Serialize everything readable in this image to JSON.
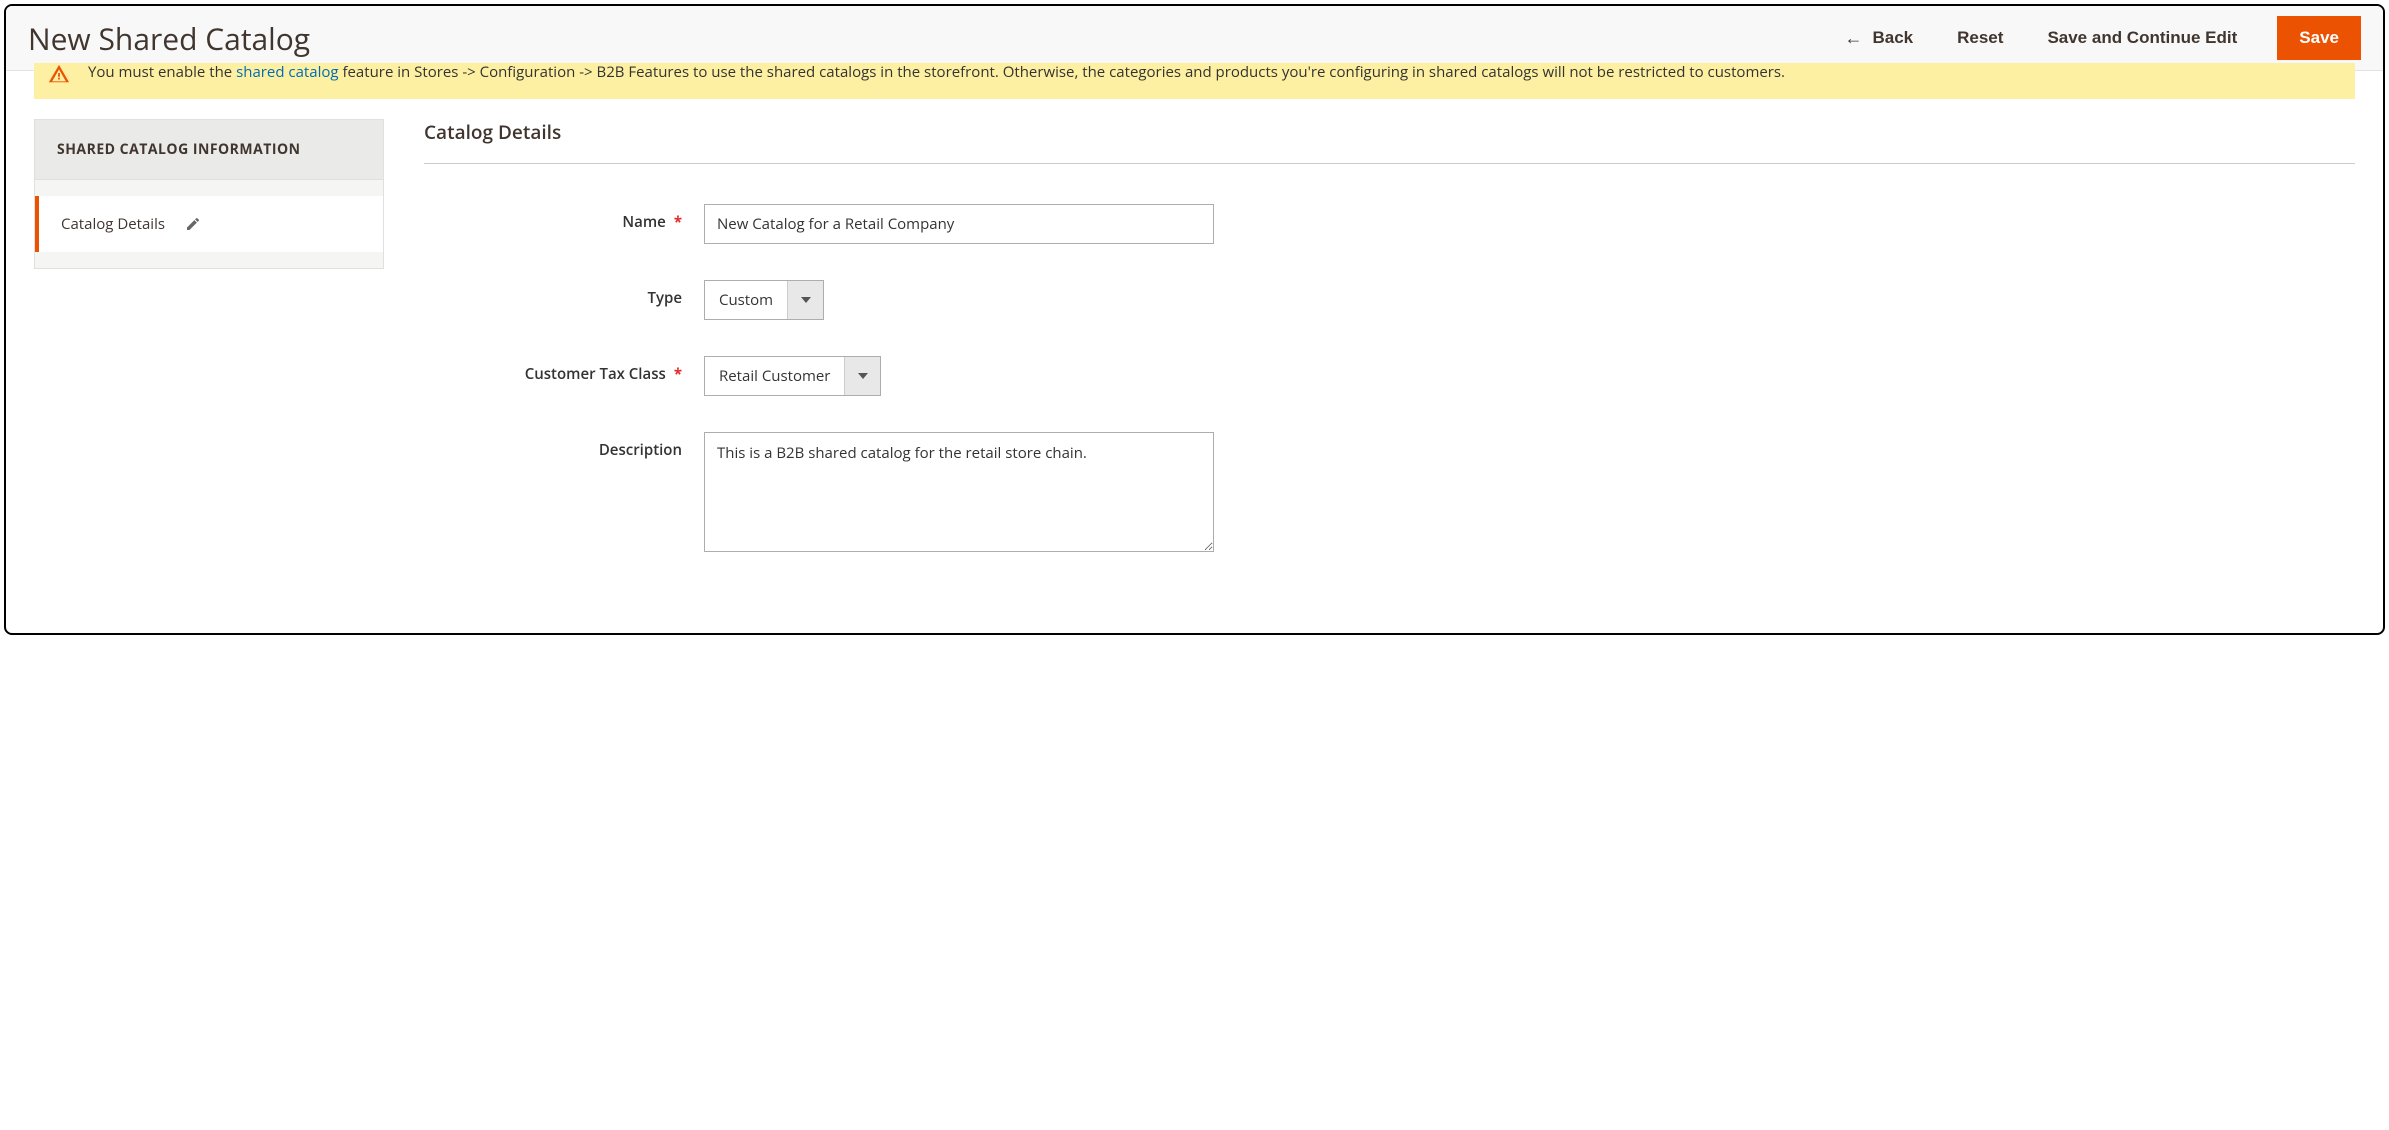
{
  "header": {
    "title": "New Shared Catalog",
    "actions": {
      "back": "Back",
      "reset": "Reset",
      "save_continue": "Save and Continue Edit",
      "save": "Save"
    }
  },
  "notice": {
    "pre_link": "You must enable the ",
    "link_text": "shared catalog",
    "post_link": " feature in Stores -> Configuration -> B2B Features to use the shared catalogs in the storefront. Otherwise, the categories and products you're configuring in shared catalogs will not be restricted to customers."
  },
  "sidebar": {
    "header": "SHARED CATALOG INFORMATION",
    "item_label": "Catalog Details"
  },
  "form": {
    "panel_title": "Catalog Details",
    "name": {
      "label": "Name",
      "value": "New Catalog for a Retail Company"
    },
    "type": {
      "label": "Type",
      "value": "Custom"
    },
    "tax_class": {
      "label": "Customer Tax Class",
      "value": "Retail Customer"
    },
    "description": {
      "label": "Description",
      "value": "This is a B2B shared catalog for the retail store chain."
    }
  },
  "colors": {
    "accent": "#eb5202",
    "notice_bg": "#fdf0a2",
    "link": "#006bb4"
  }
}
